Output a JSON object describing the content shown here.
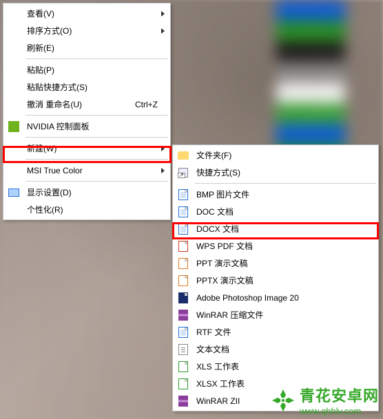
{
  "primary_menu": {
    "items": [
      {
        "label": "查看(V)",
        "has_arrow": true
      },
      {
        "label": "排序方式(O)",
        "has_arrow": true
      },
      {
        "label": "刷新(E)"
      },
      {
        "sep": true
      },
      {
        "label": "粘贴(P)"
      },
      {
        "label": "粘贴快捷方式(S)"
      },
      {
        "label": "撤消 重命名(U)",
        "shortcut": "Ctrl+Z"
      },
      {
        "sep": true
      },
      {
        "label": "NVIDIA 控制面板",
        "icon": "nvidia"
      },
      {
        "sep": true
      },
      {
        "label": "新建(W)",
        "has_arrow": true,
        "highlighted": true
      },
      {
        "sep": true
      },
      {
        "label": "MSI True Color",
        "has_arrow": true
      },
      {
        "sep": true
      },
      {
        "label": "显示设置(D)",
        "icon": "display"
      },
      {
        "label": "个性化(R)"
      }
    ]
  },
  "sub_menu": {
    "items": [
      {
        "label": "文件夹(F)",
        "icon": "folder"
      },
      {
        "label": "快捷方式(S)",
        "icon": "shortcut"
      },
      {
        "sep": true
      },
      {
        "label": "BMP 图片文件",
        "icon": "file",
        "color": "blue"
      },
      {
        "label": "DOC 文档",
        "icon": "file",
        "color": "blue"
      },
      {
        "label": "DOCX 文档",
        "icon": "file",
        "color": "blue",
        "highlighted": true
      },
      {
        "label": "WPS PDF 文档",
        "icon": "file",
        "color": "red"
      },
      {
        "label": "PPT 演示文稿",
        "icon": "file",
        "color": "orange"
      },
      {
        "label": "PPTX 演示文稿",
        "icon": "file",
        "color": "orange"
      },
      {
        "label": "Adobe Photoshop Image 20",
        "icon": "file",
        "color": "navy"
      },
      {
        "label": "WinRAR 压缩文件",
        "icon": "rar"
      },
      {
        "label": "RTF 文件",
        "icon": "file",
        "color": "blue"
      },
      {
        "label": "文本文档",
        "icon": "txt"
      },
      {
        "label": "XLS 工作表",
        "icon": "file",
        "color": "green"
      },
      {
        "label": "XLSX 工作表",
        "icon": "file",
        "color": "green"
      },
      {
        "label": "WinRAR ZII",
        "icon": "rar"
      }
    ]
  },
  "watermark": {
    "title": "青花安卓网",
    "url": "www.qhhlv.com"
  }
}
